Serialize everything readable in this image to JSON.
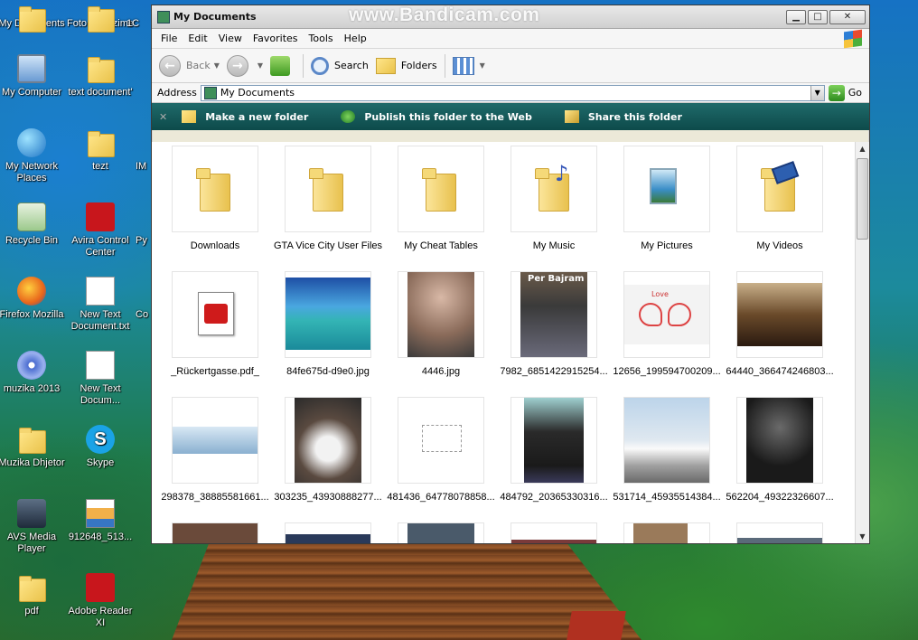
{
  "watermark": "www.Bandicam.com",
  "window": {
    "title": "My Documents",
    "buttons": {
      "minimize": "▁",
      "maximize": "□",
      "close": "✕"
    }
  },
  "menu": [
    "File",
    "Edit",
    "View",
    "Favorites",
    "Tools",
    "Help"
  ],
  "toolbar": {
    "back": "Back",
    "search": "Search",
    "folders": "Folders"
  },
  "address": {
    "label": "Address",
    "value": "My Documents",
    "go": "Go"
  },
  "tasks": {
    "new_folder": "Make a new folder",
    "publish": "Publish this folder to the Web",
    "share": "Share this folder"
  },
  "files": [
    {
      "name": "Downloads",
      "kind": "folder"
    },
    {
      "name": "GTA Vice City User Files",
      "kind": "folder"
    },
    {
      "name": "My Cheat Tables",
      "kind": "folder"
    },
    {
      "name": "My Music",
      "kind": "music-folder"
    },
    {
      "name": "My Pictures",
      "kind": "pictures-folder"
    },
    {
      "name": "My Videos",
      "kind": "videos-folder"
    },
    {
      "name": "_Rückertgasse.pdf_",
      "kind": "pdf"
    },
    {
      "name": "84fe675d-d9e0.jpg",
      "kind": "image"
    },
    {
      "name": "4446.jpg",
      "kind": "image"
    },
    {
      "name": "7982_6851422915254...",
      "kind": "image"
    },
    {
      "name": "12656_199594700209...",
      "kind": "image"
    },
    {
      "name": "64440_366474246803...",
      "kind": "image"
    },
    {
      "name": "298378_38885581661...",
      "kind": "image"
    },
    {
      "name": "303235_43930888277...",
      "kind": "image"
    },
    {
      "name": "481436_64778078858...",
      "kind": "image"
    },
    {
      "name": "484792_20365330316...",
      "kind": "image"
    },
    {
      "name": "531714_45935514384...",
      "kind": "image"
    },
    {
      "name": "562204_49322326607...",
      "kind": "image"
    }
  ],
  "thumb_text": {
    "per_bajram": "Per Bajram",
    "love": "Love"
  },
  "desktop": [
    {
      "label": "My Documents",
      "icon": "folder-icon"
    },
    {
      "label": "Foto T'Perzime",
      "icon": "folder-icon"
    },
    {
      "label": "1C",
      "icon": "folder-icon"
    },
    {
      "label": "My Computer",
      "icon": "computer-icon"
    },
    {
      "label": "text document'",
      "icon": "folder-icon"
    },
    {
      "label": "My Network Places",
      "icon": "network-icon"
    },
    {
      "label": "tezt",
      "icon": "folder-icon"
    },
    {
      "label": "IM",
      "icon": "folder-icon"
    },
    {
      "label": "Recycle Bin",
      "icon": "recycle-bin-icon"
    },
    {
      "label": "Avira Control Center",
      "icon": "avira-icon"
    },
    {
      "label": "Py",
      "icon": "folder-icon"
    },
    {
      "label": "Firefox Mozilla",
      "icon": "firefox-icon"
    },
    {
      "label": "New Text Document.txt",
      "icon": "text-document-icon"
    },
    {
      "label": "Co",
      "icon": "folder-icon"
    },
    {
      "label": "muzika 2013",
      "icon": "music-disc-icon"
    },
    {
      "label": "New Text Docum...",
      "icon": "text-document-icon"
    },
    {
      "label": "Muzika Dhjetor",
      "icon": "folder-icon"
    },
    {
      "label": "Skype",
      "icon": "skype-icon"
    },
    {
      "label": "AVS Media Player",
      "icon": "media-player-icon"
    },
    {
      "label": "912648_513...",
      "icon": "image-file-icon"
    },
    {
      "label": "pdf",
      "icon": "folder-icon"
    },
    {
      "label": "Adobe Reader XI",
      "icon": "adobe-reader-icon"
    }
  ],
  "colors": {
    "task_bar": "#0f5252",
    "window_chrome": "#ece9d8",
    "folder_yellow": "#f5d978"
  }
}
